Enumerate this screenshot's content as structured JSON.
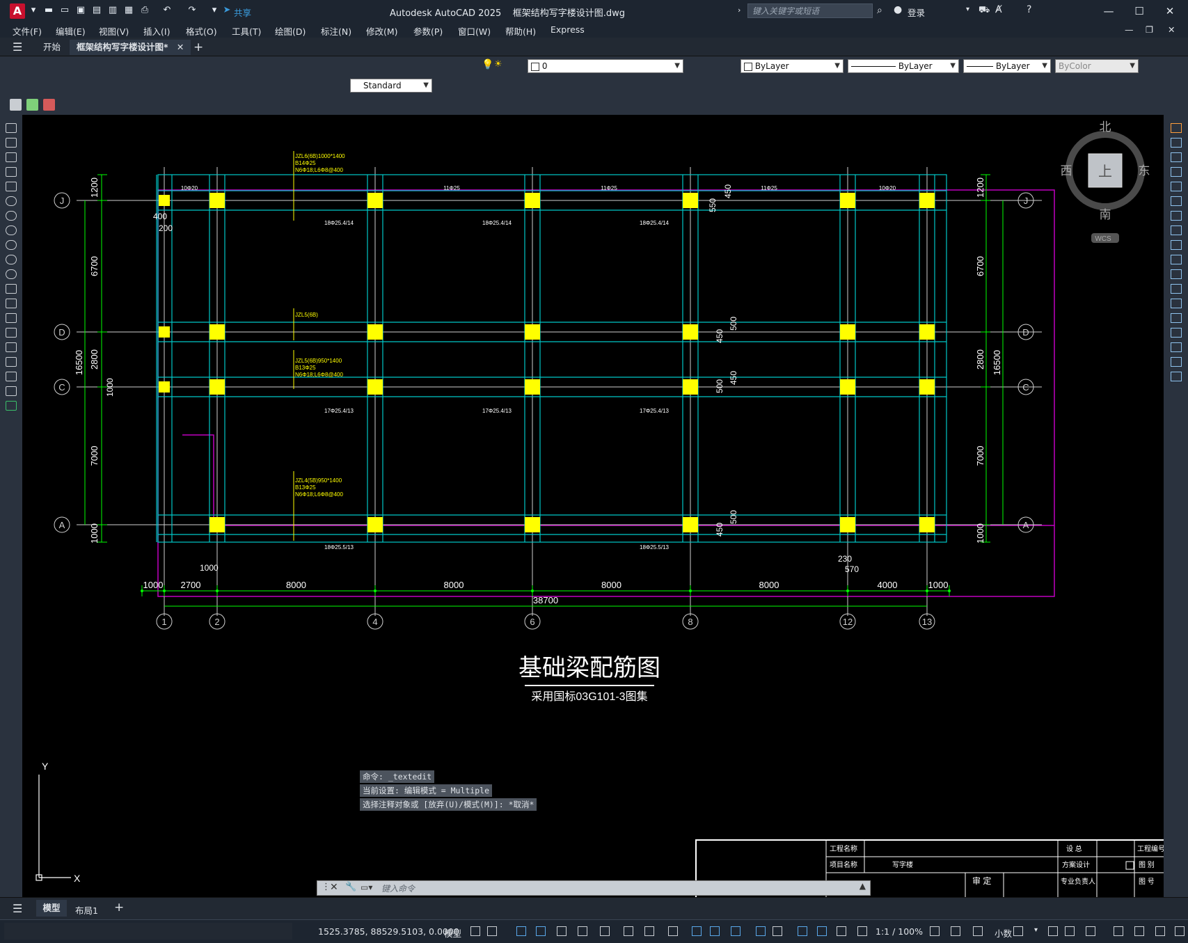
{
  "titlebar": {
    "app_title": "Autodesk AutoCAD 2025",
    "document": "框架结构写字楼设计图.dwg",
    "share_label": "共享",
    "search_placeholder": "键入关键字或短语",
    "login_label": "登录"
  },
  "menu": [
    "文件(F)",
    "编辑(E)",
    "视图(V)",
    "插入(I)",
    "格式(O)",
    "工具(T)",
    "绘图(D)",
    "标注(N)",
    "修改(M)",
    "参数(P)",
    "窗口(W)",
    "帮助(H)",
    "Express"
  ],
  "tabs": {
    "start": "开始",
    "active": "框架结构写字楼设计图*"
  },
  "properties": {
    "layer": "0",
    "color": "ByLayer",
    "linetype": "ByLayer",
    "lineweight": "ByLayer",
    "plotstyle": "ByColor",
    "dimstyle": "Standard"
  },
  "viewcube": {
    "north": "北",
    "south": "南",
    "east": "东",
    "west": "西",
    "top": "上",
    "wcs": "WCS"
  },
  "drawing": {
    "title": "基础梁配筋图",
    "subtitle": "采用国标03G101-3图集",
    "grid_rows": [
      "J",
      "D",
      "C",
      "A"
    ],
    "grid_cols": [
      "1",
      "2",
      "4",
      "6",
      "8",
      "12",
      "13"
    ],
    "bottom_dims": [
      "1000",
      "2700",
      "8000",
      "8000",
      "8000",
      "8000",
      "4000",
      "1000"
    ],
    "total_width": "38700",
    "left_dims": [
      "1200",
      "6700",
      "2800",
      "7000",
      "1000"
    ],
    "right_dims": [
      "1200",
      "6700",
      "2800",
      "7000",
      "1000"
    ],
    "total_height": "16500",
    "misc_dims": {
      "d400": "400",
      "d200": "200",
      "d1000a": "1000",
      "d1000b": "1000",
      "d230": "230",
      "d570": "570",
      "d550": "550",
      "d450a": "450",
      "d500a": "500",
      "d450b": "450",
      "d500b": "500",
      "d450c": "450",
      "d500c": "500",
      "d450d": "450"
    },
    "beam_labels_top": [
      "10Φ20",
      "11Φ25",
      "11Φ25",
      "11Φ25",
      "10Φ20"
    ],
    "beam_labels_mid": [
      "18Φ25.4/14",
      "18Φ25.4/14",
      "18Φ25.4/14"
    ],
    "beam_labels_low": [
      "17Φ25.4/13",
      "17Φ25.4/13",
      "17Φ25.4/13"
    ],
    "beam_labels_bot": [
      "18Φ25.5/13",
      "18Φ25.5/13"
    ],
    "beam_notes": [
      "JZL6(6B)1000*1400",
      "B14Φ25",
      "N6Φ18;L6Φ8@400",
      "JZL5(6B)950*1400",
      "B13Φ25",
      "N6Φ18;L6Φ8@400",
      "JZL4(5B)950*1400",
      "B13Φ25",
      "N6Φ18;L6Φ8@400",
      "JZL5(6B)"
    ]
  },
  "command": {
    "history": [
      "命令: _textedit",
      "当前设置: 编辑模式 = Multiple",
      "选择注释对象或 [放弃(U)/模式(M)]: *取消*"
    ],
    "placeholder": "键入命令"
  },
  "titleblock": {
    "project_name_label": "工程名称",
    "item_name_label": "项目名称",
    "item_name": "写字楼",
    "review_label": "审  定",
    "design_label": "设  总",
    "scheme_label": "方案设计",
    "pm_label": "专业负责人",
    "proj_no_label": "工程编号",
    "sheet_label": "图  别",
    "sheet_no_label": "图  号"
  },
  "layout_tabs": [
    "模型",
    "布局1"
  ],
  "status": {
    "coords": "1525.3785, 88529.5103, 0.0000",
    "model": "模型",
    "scale": "1:1 / 100%",
    "units": "小数"
  }
}
